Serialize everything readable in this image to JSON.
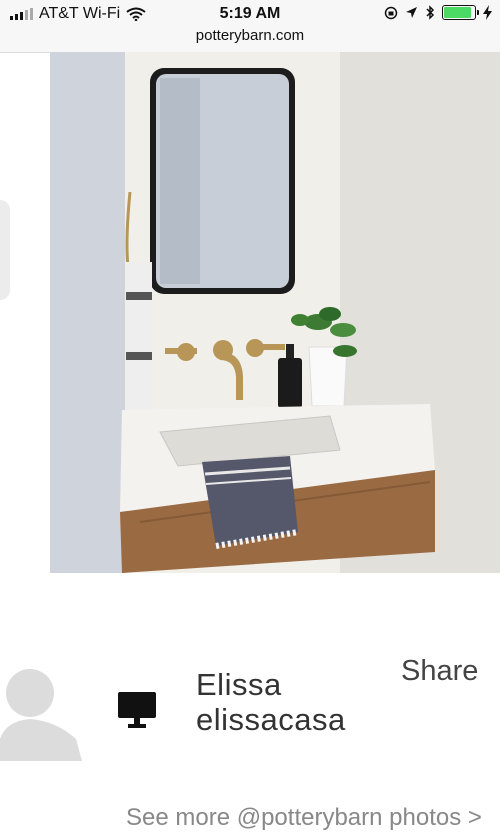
{
  "status_bar": {
    "carrier": "AT&T Wi-Fi",
    "time": "5:19 AM",
    "url": "potterybarn.com",
    "battery_level": 0.9,
    "icons": [
      "signal-icon",
      "wifi-icon",
      "orientation-lock-icon",
      "location-icon",
      "bluetooth-icon",
      "battery-icon",
      "charging-icon"
    ]
  },
  "photo": {
    "subject_icon": "bathroom-photo"
  },
  "author": {
    "name": "Elissa",
    "handle": "elissacasa",
    "share_label": "Share",
    "avatar_icon": "avatar-placeholder-icon",
    "device_icon": "desktop-icon"
  },
  "footer": {
    "see_more_label": "See more @potterybarn photos >"
  },
  "colors": {
    "battery_fill": "#4cd964",
    "text_dark": "#333333",
    "text_muted": "#888888"
  }
}
